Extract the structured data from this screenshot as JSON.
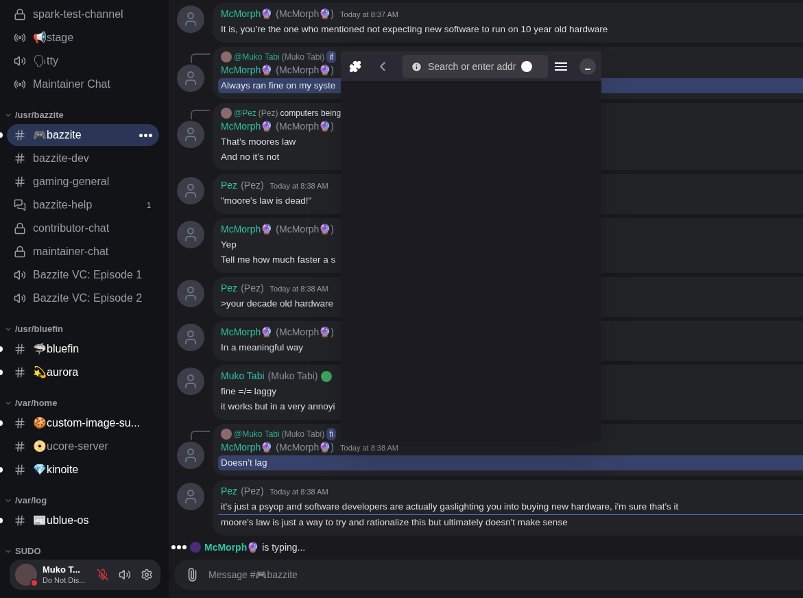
{
  "sidebar": {
    "top_channels": [
      {
        "name": "spark-test-channel",
        "kind": "lock",
        "unread": false,
        "selected": false
      },
      {
        "name": "📢stage",
        "kind": "stage",
        "unread": false,
        "selected": false
      },
      {
        "name": "🗣tty",
        "kind": "voice",
        "unread": false,
        "selected": false
      },
      {
        "name": "Maintainer Chat",
        "kind": "stage",
        "unread": false,
        "selected": false
      }
    ],
    "categories": [
      {
        "name": "/usr/bazzite",
        "expanded": true,
        "channels": [
          {
            "name": "🎮bazzite",
            "kind": "text",
            "unread": true,
            "selected": true
          },
          {
            "name": "bazzite-dev",
            "kind": "text",
            "unread": false,
            "selected": false
          },
          {
            "name": "gaming-general",
            "kind": "text",
            "unread": false,
            "selected": false
          },
          {
            "name": "bazzite-help",
            "kind": "forum",
            "unread": false,
            "selected": false,
            "badge": "1"
          },
          {
            "name": "contributor-chat",
            "kind": "lock",
            "unread": false,
            "selected": false
          },
          {
            "name": "maintainer-chat",
            "kind": "lock",
            "unread": false,
            "selected": false
          },
          {
            "name": "Bazzite VC: Episode 1",
            "kind": "voice",
            "unread": false,
            "selected": false
          },
          {
            "name": "Bazzite VC: Episode 2",
            "kind": "voice",
            "unread": false,
            "selected": false
          }
        ]
      },
      {
        "name": "/usr/bluefin",
        "expanded": true,
        "channels": [
          {
            "name": "🦈bluefin",
            "kind": "text",
            "unread": true,
            "selected": false
          },
          {
            "name": "💫aurora",
            "kind": "text",
            "unread": true,
            "selected": false
          }
        ]
      },
      {
        "name": "/var/home",
        "expanded": true,
        "channels": [
          {
            "name": "🍪custom-image-su...",
            "kind": "text",
            "unread": true,
            "selected": false
          },
          {
            "name": "📀ucore-server",
            "kind": "text",
            "unread": false,
            "selected": false
          },
          {
            "name": "💎kinoite",
            "kind": "text",
            "unread": true,
            "selected": false
          }
        ]
      },
      {
        "name": "/var/log",
        "expanded": true,
        "channels": [
          {
            "name": "📰ublue-os",
            "kind": "text",
            "unread": true,
            "selected": false
          }
        ]
      },
      {
        "name": "SUDO",
        "expanded": true
      }
    ],
    "user": {
      "name": "Muko T...",
      "status": "Do Not Dis...",
      "mic_muted": true
    }
  },
  "messages": [
    {
      "author": "McMorph🔮",
      "display": "(McMorph🔮)",
      "time": "Today at 8:37 AM",
      "lines": [
        {
          "text": "It is, you’re the one who mentioned not expecting new software to run on 10 year old hardware",
          "highlighted": false
        }
      ]
    },
    {
      "reply": {
        "author": "@Muko Tabi",
        "display": "(Muko Tabi)",
        "snippet": "if",
        "highlighted": true
      },
      "author": "McMorph🔮",
      "display": "(McMorph🔮)",
      "lines": [
        {
          "text": "Always ran fine on my syste",
          "highlighted": true
        }
      ]
    },
    {
      "reply": {
        "author": "@Pez",
        "display": "(Pez)",
        "snippet": "computers being",
        "highlighted": false
      },
      "author": "McMorph🔮",
      "display": "(McMorph🔮)",
      "lines": [
        {
          "text": "That’s moores law",
          "highlighted": false
        },
        {
          "text": "And no it’s not",
          "highlighted": false
        }
      ]
    },
    {
      "author": "Pez",
      "display": "(Pez)",
      "time": "Today at 8:38 AM",
      "lines": [
        {
          "text": "\"moore's law is dead!\"",
          "highlighted": false
        }
      ]
    },
    {
      "author": "McMorph🔮",
      "display": "(McMorph🔮)",
      "lines": [
        {
          "text": "Yep",
          "highlighted": false
        },
        {
          "text": "Tell me how much faster a s",
          "highlighted": false
        }
      ]
    },
    {
      "author": "Pez",
      "display": "(Pez)",
      "time": "Today at 8:38 AM",
      "lines": [
        {
          "text": ">your decade old hardware",
          "highlighted": false
        }
      ]
    },
    {
      "author": "McMorph🔮",
      "display": "(McMorph🔮)",
      "lines": [
        {
          "text": "In a meaningful way",
          "highlighted": false
        }
      ]
    },
    {
      "author": "Muko Tabi",
      "display": "(Muko Tabi)",
      "badge": true,
      "lines": [
        {
          "text": "fine =/= laggy",
          "highlighted": false
        },
        {
          "text": "it works but in a very annoyi",
          "highlighted": false
        }
      ]
    },
    {
      "reply": {
        "author": "@Muko Tabi",
        "display": "(Muko Tabi)",
        "snippet": "fi",
        "highlighted": true
      },
      "author": "McMorph🔮",
      "display": "(McMorph🔮)",
      "time": "Today at 8:38 AM",
      "lines": [
        {
          "text": "Doesn’t lag",
          "highlighted": true
        }
      ]
    },
    {
      "author": "Pez",
      "display": "(Pez)",
      "time": "Today at 8:38 AM",
      "unread_divider": true,
      "lines": [
        {
          "text": "it's just a psyop and software developers are actually gaslighting you into buying new hardware, i'm sure that's it",
          "highlighted": false
        },
        {
          "text": "moore's law is just a way to try and rationalize this but ultimately doesn't make sense",
          "highlighted": false
        }
      ]
    }
  ],
  "typing": {
    "name": "McMorph🔮",
    "text": "is typing..."
  },
  "composer": {
    "placeholder": "Message #🎮bazzite"
  },
  "popup": {
    "address_placeholder": "Search or enter addr"
  }
}
